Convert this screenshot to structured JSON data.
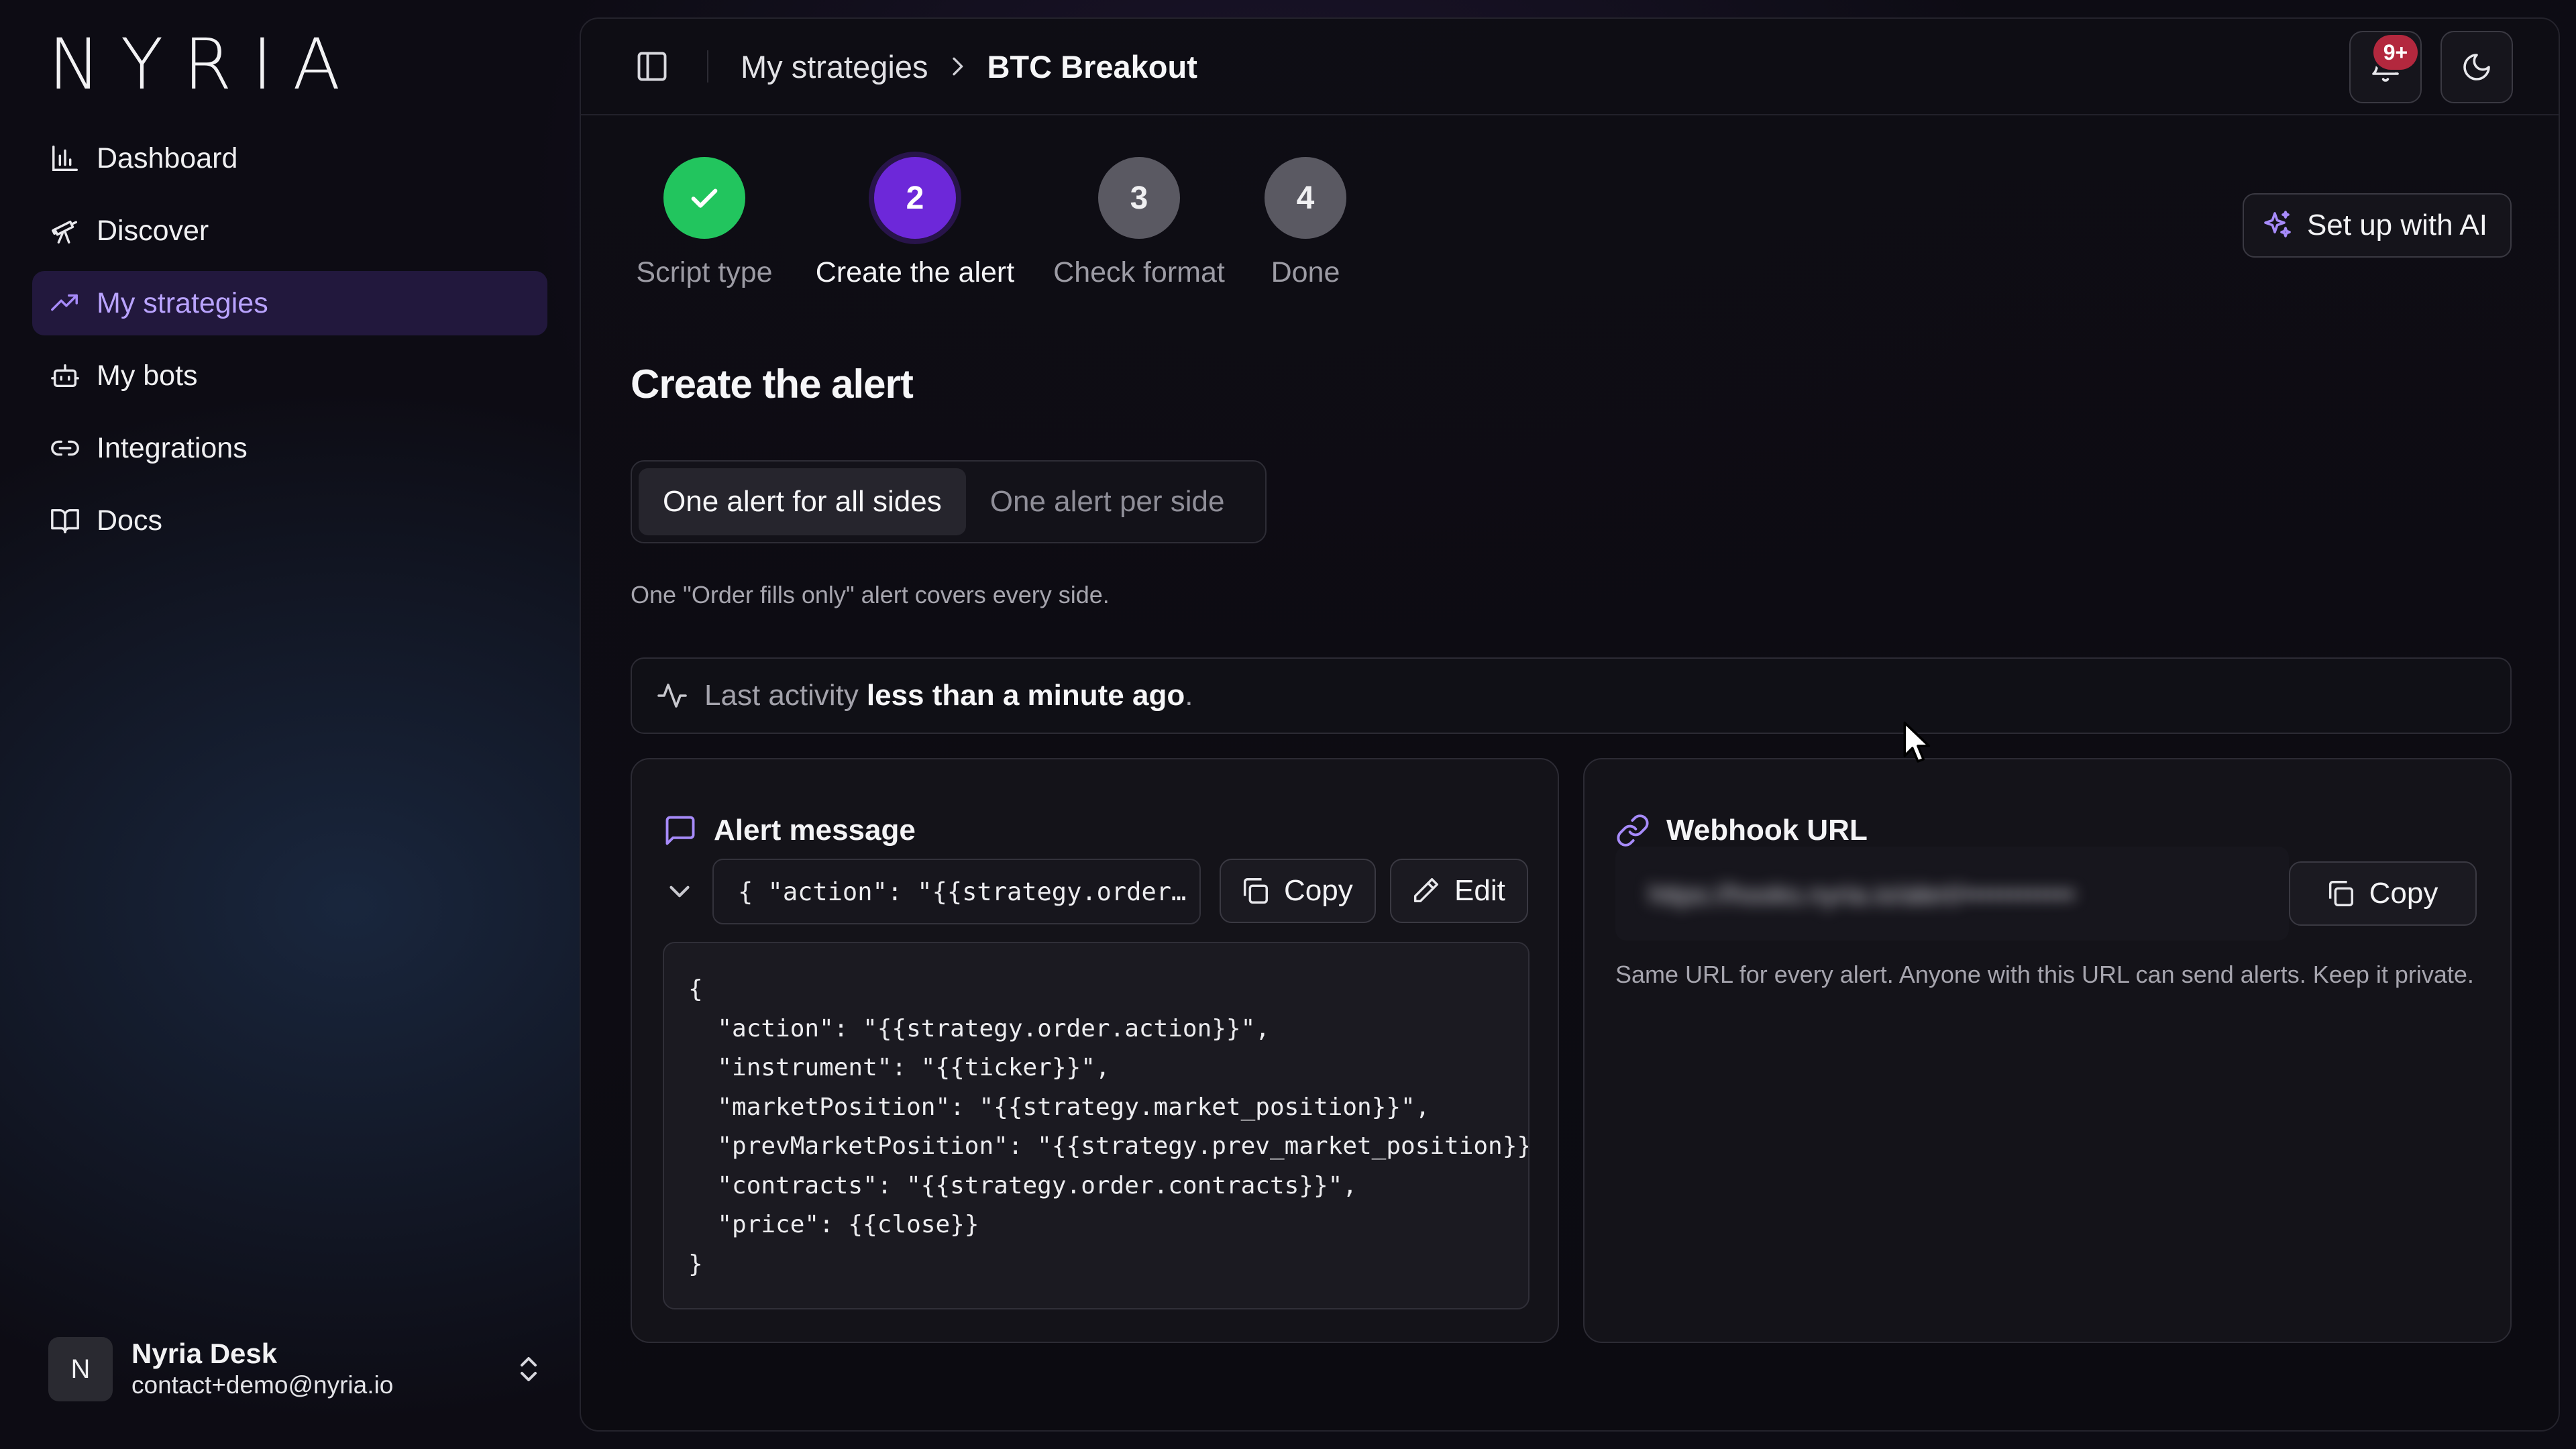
{
  "app": {
    "logo": "NYRIA"
  },
  "sidebar": {
    "items": [
      {
        "label": "Dashboard",
        "icon": "bar-chart-icon",
        "active": false
      },
      {
        "label": "Discover",
        "icon": "telescope-icon",
        "active": false
      },
      {
        "label": "My strategies",
        "icon": "trending-up-icon",
        "active": true
      },
      {
        "label": "My bots",
        "icon": "bot-icon",
        "active": false
      },
      {
        "label": "Integrations",
        "icon": "link-icon",
        "active": false
      },
      {
        "label": "Docs",
        "icon": "book-icon",
        "active": false
      }
    ],
    "user": {
      "initial": "N",
      "name": "Nyria Desk",
      "email": "contact+demo@nyria.io"
    }
  },
  "header": {
    "breadcrumb": [
      "My strategies",
      "BTC Breakout"
    ],
    "notifications_badge": "9+"
  },
  "stepper": {
    "steps": [
      {
        "number": "1",
        "label": "Script type",
        "state": "done"
      },
      {
        "number": "2",
        "label": "Create the alert",
        "state": "current"
      },
      {
        "number": "3",
        "label": "Check format",
        "state": "pending"
      },
      {
        "number": "4",
        "label": "Done",
        "state": "pending"
      }
    ]
  },
  "ai_button": {
    "label": "Set up with AI"
  },
  "section": {
    "title": "Create the alert",
    "segmented": {
      "options": [
        "One alert for all sides",
        "One alert per side"
      ],
      "selected": "One alert for all sides"
    },
    "help": "One \"Order fills only\" alert covers every side."
  },
  "activity": {
    "prefix": "Last activity",
    "value": "less than a minute ago",
    "suffix": "."
  },
  "alert_card": {
    "title": "Alert message",
    "preview": "{ \"action\": \"{{strategy.order…",
    "copy_label": "Copy",
    "edit_label": "Edit",
    "code_lines": [
      "{",
      "  \"action\": \"{{strategy.order.action}}\",",
      "  \"instrument\": \"{{ticker}}\",",
      "  \"marketPosition\": \"{{strategy.market_position}}\",",
      "  \"prevMarketPosition\": \"{{strategy.prev_market_position}}\",",
      "  \"contracts\": \"{{strategy.order.contracts}}\",",
      "  \"price\": {{close}}",
      "}"
    ]
  },
  "webhook_card": {
    "title": "Webhook URL",
    "url_masked": "https://hooks.nyria.io/alert/••••••••••••",
    "copy_label": "Copy",
    "help": "Same URL for every alert. Anyone with this URL can send alerts. Keep it private."
  },
  "colors": {
    "accent": "#a78bfa",
    "step_done": "#22c55e",
    "step_current": "#6d28d9",
    "step_pending": "#5a5962",
    "badge": "#b3283e"
  }
}
